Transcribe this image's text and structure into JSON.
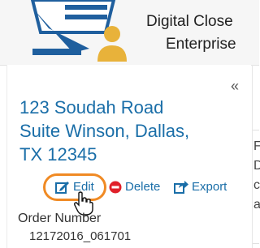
{
  "header": {
    "brand_line1": "Digital Close",
    "brand_line2": "Enterprise"
  },
  "sidebar": {
    "collapse_icon": "double-chevron-left-icon",
    "address": "123 Soudah Road\nSuite Winson, Dallas,\nTX 12345",
    "actions": {
      "edit_label": "Edit",
      "delete_label": "Delete",
      "export_label": "Export"
    },
    "order_label": "Order Number",
    "order_value": "12172016_061701"
  },
  "right_panel": {
    "letters": [
      "F",
      "D",
      "c",
      "a"
    ]
  },
  "colors": {
    "link": "#1a6ea8",
    "highlight": "#f08a24",
    "delete_red": "#e0202a",
    "logo_blue": "#1f5f9e",
    "logo_gold": "#e8b23a"
  }
}
